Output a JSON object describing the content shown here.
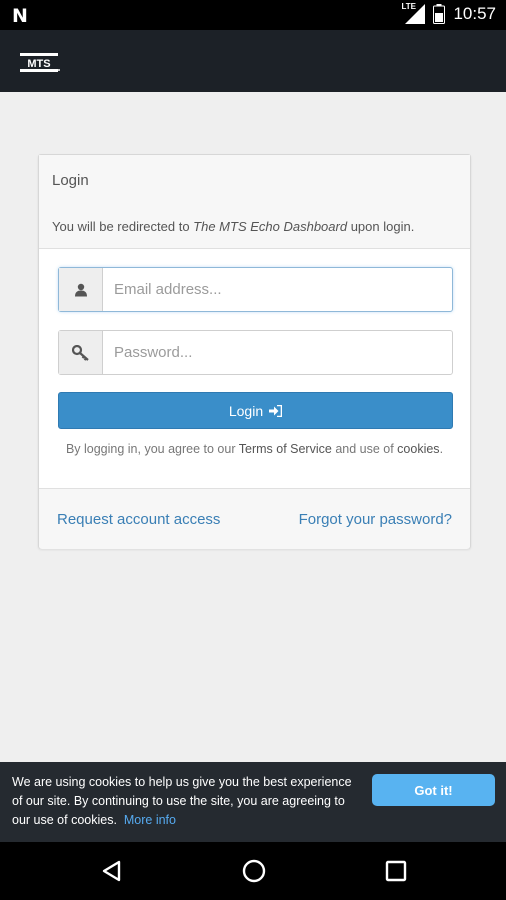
{
  "status_bar": {
    "network_label": "LTE",
    "time": "10:57"
  },
  "app_bar": {
    "logo_text": "MTS"
  },
  "login_card": {
    "title": "Login",
    "redirect_prefix": "You will be redirected to ",
    "redirect_target": "The MTS Echo Dashboard",
    "redirect_suffix": " upon login.",
    "email_placeholder": "Email address...",
    "password_placeholder": "Password...",
    "login_button": "Login",
    "agree_prefix": "By logging in, you agree to our ",
    "terms_link": "Terms of Service",
    "agree_middle": " and use of ",
    "cookies_link": "cookies",
    "agree_suffix": ".",
    "request_access_link": "Request account access",
    "forgot_password_link": "Forgot your password?"
  },
  "cookie_banner": {
    "message": "We are using cookies to help us give you the best experience of our site. By continuing to use the site, you are agreeing to our use of cookies.",
    "more_info_link": "More info",
    "accept_button": "Got it!"
  },
  "nav_bar": {
    "buttons": [
      "back-icon",
      "home-icon",
      "recents-icon"
    ]
  },
  "colors": {
    "app_bar": "#1c2127",
    "primary_button": "#3a8ec9",
    "link": "#3a7fb5",
    "cookie_banner": "#252a30",
    "cookie_button": "#58b3f1"
  }
}
